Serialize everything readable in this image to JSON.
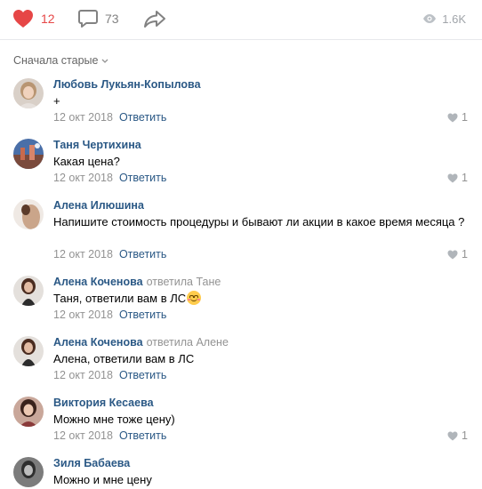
{
  "actions": {
    "likes": "12",
    "comments": "73",
    "views": "1.6K"
  },
  "sort": {
    "label": "Сначала старые"
  },
  "comments": [
    {
      "author": "Любовь Лукьян-Копылова",
      "reply_to": "",
      "text": "+",
      "date": "12 окт 2018",
      "reply_label": "Ответить",
      "likes": "1"
    },
    {
      "author": "Таня Чертихина",
      "reply_to": "",
      "text": "Какая цена?",
      "date": "12 окт 2018",
      "reply_label": "Ответить",
      "likes": "1"
    },
    {
      "author": "Алена Илюшина",
      "reply_to": "",
      "text": "Напишите стоимость процедуры и бывают ли акции в какое время месяца ?",
      "date": "12 окт 2018",
      "reply_label": "Ответить",
      "likes": "1"
    },
    {
      "author": "Алена Коченова",
      "reply_verb": "ответила",
      "reply_to": "Тане",
      "text": "Таня, ответили вам в ЛС",
      "emoji": "smile-blush",
      "date": "12 окт 2018",
      "reply_label": "Ответить",
      "likes": ""
    },
    {
      "author": "Алена Коченова",
      "reply_verb": "ответила",
      "reply_to": "Алене",
      "text": "Алена, ответили вам в ЛС",
      "date": "12 окт 2018",
      "reply_label": "Ответить",
      "likes": ""
    },
    {
      "author": "Виктория Кесаева",
      "reply_to": "",
      "text": "Можно мне тоже цену)",
      "date": "12 окт 2018",
      "reply_label": "Ответить",
      "likes": "1"
    },
    {
      "author": "Зиля Бабаева",
      "reply_to": "",
      "text": "Можно и мне цену",
      "date": "",
      "reply_label": "",
      "likes": ""
    }
  ],
  "colors": {
    "like_active": "#e64646",
    "link": "#2a5885",
    "muted": "#939393",
    "divider": "#e7e8ec"
  }
}
